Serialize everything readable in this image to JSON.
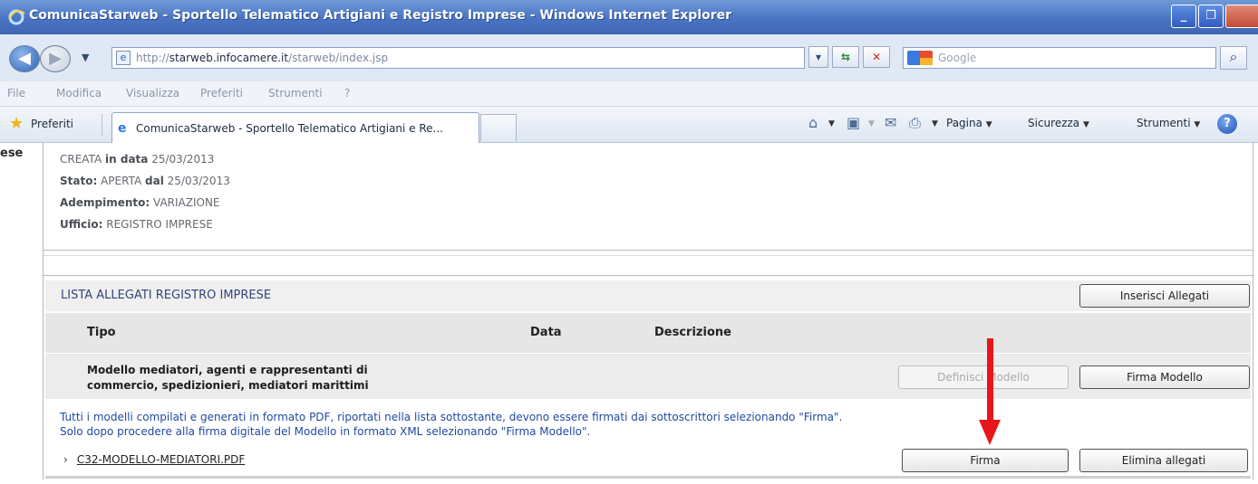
{
  "window": {
    "title": "ComunicaStarweb - Sportello Telematico Artigiani e Registro Imprese - Windows Internet Explorer"
  },
  "address": {
    "url_prefix": "http://",
    "url_host": "starweb.infocamere.it",
    "url_path": "/starweb/index.jsp",
    "search_placeholder": "Google"
  },
  "menu": [
    "File",
    "Modifica",
    "Visualizza",
    "Preferiti",
    "Strumenti",
    "?"
  ],
  "favbar": {
    "favorites_label": "Preferiti",
    "tab_title": "ComunicaStarweb - Sportello Telematico Artigiani e Re...",
    "commands": {
      "page": "Pagina",
      "security": "Sicurezza",
      "tools": "Strumenti"
    }
  },
  "content": {
    "left_cut_text": "ese",
    "info": {
      "created_value": "CREATA",
      "created_label": "in data",
      "created_date": "25/03/2013",
      "state_label": "Stato:",
      "state_value": "APERTA",
      "state_since_label": "dal",
      "state_date": "25/03/2013",
      "task_label": "Adempimento:",
      "task_value": "VARIAZIONE",
      "office_label": "Ufficio:",
      "office_value": "REGISTRO IMPRESE"
    },
    "section_title": "LISTA ALLEGATI REGISTRO IMPRESE",
    "insert_attachments_button": "Inserisci Allegati",
    "columns": [
      "Tipo",
      "Data",
      "Descrizione"
    ],
    "model": {
      "name_line1": "Modello mediatori, agenti e rappresentanti di",
      "name_line2": "commercio, spedizionieri, mediatori marittimi",
      "define_button": "Definisci Modello",
      "sign_model_button": "Firma Modello"
    },
    "notice": {
      "line1": "Tutti i modelli compilati e generati in formato PDF, riportati nella lista sottostante, devono essere firmati dai sottoscrittori selezionando \"Firma\".",
      "line2": "Solo dopo procedere alla firma digitale del Modello in formato XML selezionando \"Firma Modello\"."
    },
    "file": {
      "name": "C32-MODELLO-MEDIATORI.PDF",
      "sign_button": "Firma",
      "delete_button": "Elimina allegati"
    }
  },
  "colors": {
    "title_bar": "#4a74c2",
    "link_blue": "#1f4aa0",
    "arrow_red": "#e8161a"
  }
}
